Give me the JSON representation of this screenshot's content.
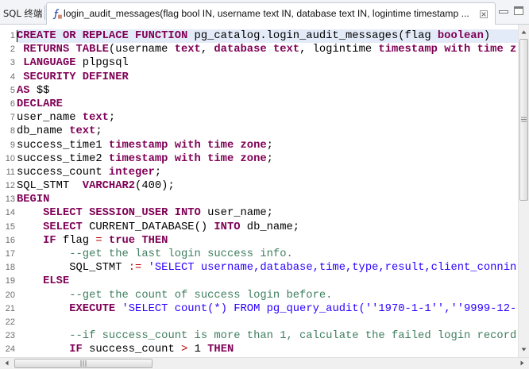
{
  "tabs": {
    "terminal": {
      "label": "SQL 终端"
    },
    "function_editor": {
      "label": "login_audit_messages(flag bool IN, username text IN, database text IN, logintime timestamp ...",
      "icon": "function-icon",
      "close_icon": "close-icon"
    }
  },
  "window_controls": {
    "minimize_icon": "minimize-icon",
    "maximize_icon": "maximize-icon"
  },
  "scrollbars": {
    "vertical": {
      "up_icon": "scroll-up-icon",
      "down_icon": "scroll-down-icon",
      "grip_icon": "grip-icon"
    },
    "horizontal": {
      "left_icon": "scroll-left-icon",
      "right_icon": "scroll-right-icon",
      "grip_icon": "grip-icon"
    }
  },
  "editor": {
    "current_line": 1,
    "current_line_color": "#e4ebf8",
    "syntax_colors": {
      "keyword": "#7f0055",
      "string": "#2a00ff",
      "comment": "#3f7f5f",
      "operator": "#c00000",
      "plain": "#000000"
    },
    "lines": [
      {
        "n": 1,
        "tokens": [
          [
            "kw",
            "CREATE OR REPLACE FUNCTION"
          ],
          [
            "p",
            " pg_catalog.login_audit_messages(flag "
          ],
          [
            "kw",
            "boolean"
          ],
          [
            "p",
            ")"
          ]
        ]
      },
      {
        "n": 2,
        "tokens": [
          [
            "p",
            " "
          ],
          [
            "kw",
            "RETURNS TABLE"
          ],
          [
            "p",
            "(username "
          ],
          [
            "kw",
            "text"
          ],
          [
            "p",
            ", "
          ],
          [
            "kw",
            "database"
          ],
          [
            "p",
            " "
          ],
          [
            "kw",
            "text"
          ],
          [
            "p",
            ", logintime "
          ],
          [
            "kw",
            "timestamp with time z"
          ]
        ]
      },
      {
        "n": 3,
        "tokens": [
          [
            "p",
            " "
          ],
          [
            "kw",
            "LANGUAGE"
          ],
          [
            "p",
            " plpgsql"
          ]
        ]
      },
      {
        "n": 4,
        "tokens": [
          [
            "p",
            " "
          ],
          [
            "kw",
            "SECURITY DEFINER"
          ]
        ]
      },
      {
        "n": 5,
        "tokens": [
          [
            "kw",
            "AS"
          ],
          [
            "p",
            " $$"
          ]
        ]
      },
      {
        "n": 6,
        "tokens": [
          [
            "kw",
            "DECLARE"
          ]
        ]
      },
      {
        "n": 7,
        "tokens": [
          [
            "p",
            "user_name "
          ],
          [
            "kw",
            "text"
          ],
          [
            "p",
            ";"
          ]
        ]
      },
      {
        "n": 8,
        "tokens": [
          [
            "p",
            "db_name "
          ],
          [
            "kw",
            "text"
          ],
          [
            "p",
            ";"
          ]
        ]
      },
      {
        "n": 9,
        "tokens": [
          [
            "p",
            "success_time1 "
          ],
          [
            "kw",
            "timestamp with time zone"
          ],
          [
            "p",
            ";"
          ]
        ]
      },
      {
        "n": 10,
        "tokens": [
          [
            "p",
            "success_time2 "
          ],
          [
            "kw",
            "timestamp with time zone"
          ],
          [
            "p",
            ";"
          ]
        ]
      },
      {
        "n": 11,
        "tokens": [
          [
            "p",
            "success_count "
          ],
          [
            "kw",
            "integer"
          ],
          [
            "p",
            ";"
          ]
        ]
      },
      {
        "n": 12,
        "tokens": [
          [
            "p",
            "SQL_STMT  "
          ],
          [
            "kw",
            "VARCHAR2"
          ],
          [
            "p",
            "(400);"
          ]
        ]
      },
      {
        "n": 13,
        "tokens": [
          [
            "kw",
            "BEGIN"
          ]
        ]
      },
      {
        "n": 14,
        "tokens": [
          [
            "p",
            "    "
          ],
          [
            "kw",
            "SELECT SESSION_USER INTO"
          ],
          [
            "p",
            " user_name;"
          ]
        ]
      },
      {
        "n": 15,
        "tokens": [
          [
            "p",
            "    "
          ],
          [
            "kw",
            "SELECT"
          ],
          [
            "p",
            " CURRENT_DATABASE() "
          ],
          [
            "kw",
            "INTO"
          ],
          [
            "p",
            " db_name;"
          ]
        ]
      },
      {
        "n": 16,
        "tokens": [
          [
            "p",
            "    "
          ],
          [
            "kw",
            "IF"
          ],
          [
            "p",
            " flag "
          ],
          [
            "op",
            "="
          ],
          [
            "p",
            " "
          ],
          [
            "kw",
            "true THEN"
          ]
        ]
      },
      {
        "n": 17,
        "tokens": [
          [
            "p",
            "        "
          ],
          [
            "com",
            "--get the last login success info."
          ]
        ]
      },
      {
        "n": 18,
        "tokens": [
          [
            "p",
            "        SQL_STMT "
          ],
          [
            "op",
            ":="
          ],
          [
            "p",
            " "
          ],
          [
            "str",
            "'SELECT username,database,time,type,result,client_connin"
          ]
        ]
      },
      {
        "n": 19,
        "tokens": [
          [
            "p",
            "    "
          ],
          [
            "kw",
            "ELSE"
          ]
        ]
      },
      {
        "n": 20,
        "tokens": [
          [
            "p",
            "        "
          ],
          [
            "com",
            "--get the count of success login before."
          ]
        ]
      },
      {
        "n": 21,
        "tokens": [
          [
            "p",
            "        "
          ],
          [
            "kw",
            "EXECUTE"
          ],
          [
            "p",
            " "
          ],
          [
            "str",
            "'SELECT count(*) FROM pg_query_audit(''1970-1-1'',''9999-12-"
          ]
        ]
      },
      {
        "n": 22,
        "tokens": []
      },
      {
        "n": 23,
        "tokens": [
          [
            "p",
            "        "
          ],
          [
            "com",
            "--if success_count is more than 1, calculate the failed login record"
          ]
        ]
      },
      {
        "n": 24,
        "tokens": [
          [
            "p",
            "        "
          ],
          [
            "kw",
            "IF"
          ],
          [
            "p",
            " success_count "
          ],
          [
            "op",
            ">"
          ],
          [
            "p",
            " 1 "
          ],
          [
            "kw",
            "THEN"
          ]
        ]
      }
    ]
  }
}
